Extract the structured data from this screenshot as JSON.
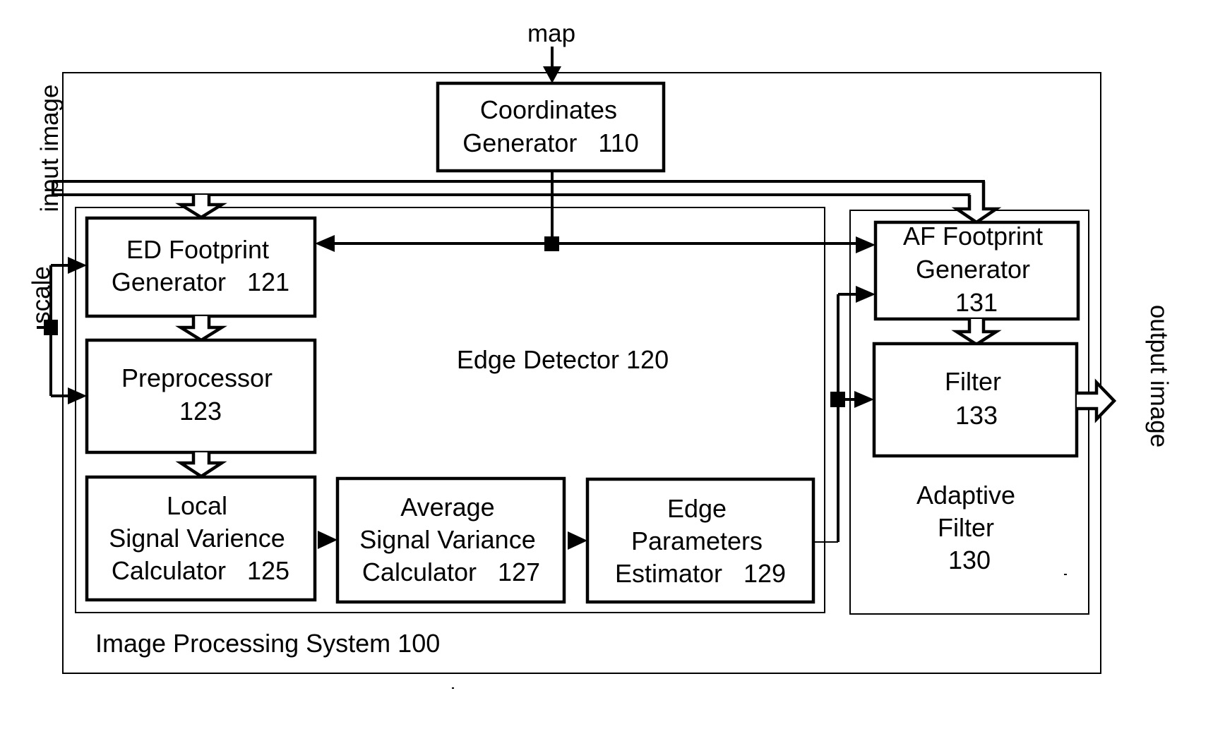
{
  "diagram": {
    "system": {
      "label": "Image Processing System 100",
      "edge_detector_label": "Edge Detector 120",
      "adaptive_filter_label": [
        "Adaptive",
        "Filter",
        "130"
      ]
    },
    "inputs": {
      "map": "map",
      "input_image": "input image",
      "scale": "scale"
    },
    "outputs": {
      "output_image": "output image"
    },
    "blocks": {
      "coordinates_generator": [
        "Coordinates",
        "Generator   110"
      ],
      "ed_footprint_generator": [
        "ED Footprint",
        "Generator   121"
      ],
      "preprocessor": [
        "Preprocessor",
        "123"
      ],
      "local_signal_variance": [
        "Local",
        "Signal Varience",
        "Calculator   125"
      ],
      "average_signal_variance": [
        "Average",
        "Signal Variance",
        "Calculator   127"
      ],
      "edge_parameters_estimator": [
        "Edge",
        "Parameters",
        "Estimator   129"
      ],
      "af_footprint_generator": [
        "AF Footprint",
        "Generator",
        "131"
      ],
      "filter": [
        "Filter",
        "133"
      ]
    }
  }
}
